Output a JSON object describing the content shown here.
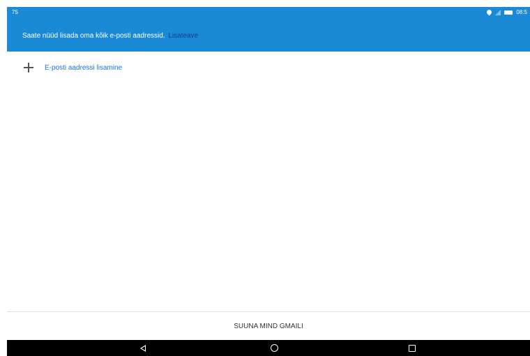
{
  "status_bar": {
    "left_text": "75",
    "time": "08:5"
  },
  "banner": {
    "text": "Saate nüüd lisada oma kõik e-posti aadressid.",
    "link": "Lisateave"
  },
  "add_email": {
    "label": "E-posti aadressi lisamine"
  },
  "footer": {
    "button_label": "SUUNA MIND GMAILI"
  },
  "colors": {
    "accent": "#1b8ad6",
    "link": "#1b73e8",
    "banner_link": "#0f3f8e"
  },
  "icons": [
    "location-icon",
    "signal-icon",
    "battery-icon",
    "plus-icon",
    "back-icon",
    "home-icon",
    "recents-icon"
  ]
}
